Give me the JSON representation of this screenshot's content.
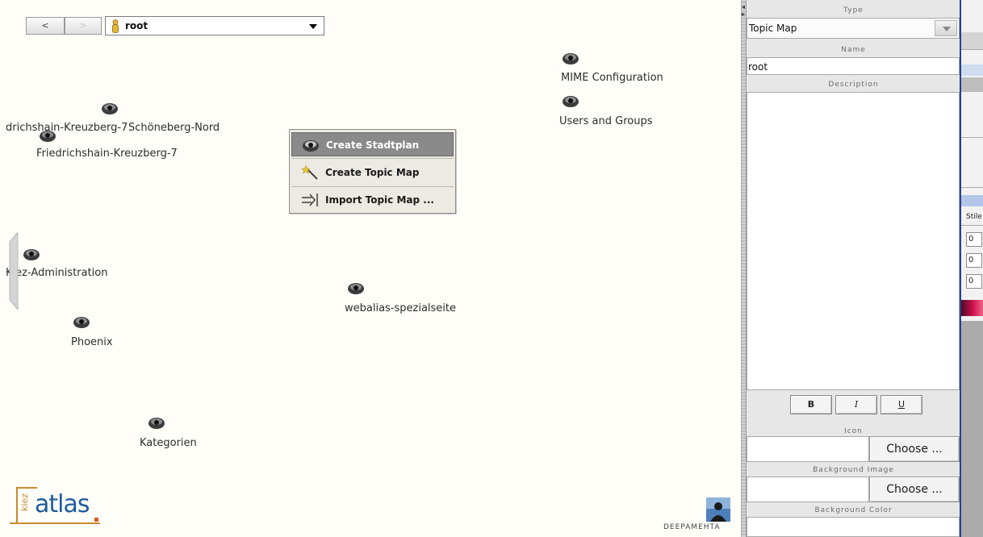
{
  "toolbar": {
    "back_label": "<",
    "forward_label": ">",
    "map_selector_value": "root"
  },
  "topics": {
    "mime_configuration": "MIME Configuration",
    "users_and_groups": "Users and Groups",
    "schoeneberg_nord": "drichshain-Kreuzberg-7",
    "schoeneberg_nord_2": "Schöneberg-Nord",
    "friedrichshain_kreuzberg_7": "Friedrichshain-Kreuzberg-7",
    "kiez_administration": "Kiez-Administration",
    "webalias_spezialseite": "webalias-spezialseite",
    "phoenix": "Phoenix",
    "kategorien": "Kategorien"
  },
  "context_menu": {
    "items": [
      {
        "label": "Create Stadtplan",
        "icon": "eye-icon"
      },
      {
        "label": "Create Topic Map",
        "icon": "magic-wand-icon"
      },
      {
        "label": "Import Topic Map ...",
        "icon": "import-arrow-icon"
      }
    ]
  },
  "logos": {
    "kiez_word": "kiez",
    "atlas_word": "atlas",
    "deepamehta": "DEEPAMEHTA"
  },
  "panel": {
    "type_label": "Type",
    "type_value": "Topic Map",
    "name_label": "Name",
    "name_value": "root",
    "description_label": "Description",
    "bold_label": "B",
    "italic_label": "I",
    "underline_label": "U",
    "icon_label": "Icon",
    "icon_choose": "Choose ...",
    "bg_image_label": "Background Image",
    "bg_image_choose": "Choose ...",
    "bg_color_label": "Background Color"
  },
  "right_edge": {
    "stile_label": "Stile",
    "values": [
      "0",
      "0",
      "0"
    ]
  },
  "colors": {
    "menu_active": "#8a8a8a",
    "atlas_blue": "#1f5c9d",
    "kiez_orange": "#c98b2e",
    "window_border": "#2a3f8f"
  }
}
